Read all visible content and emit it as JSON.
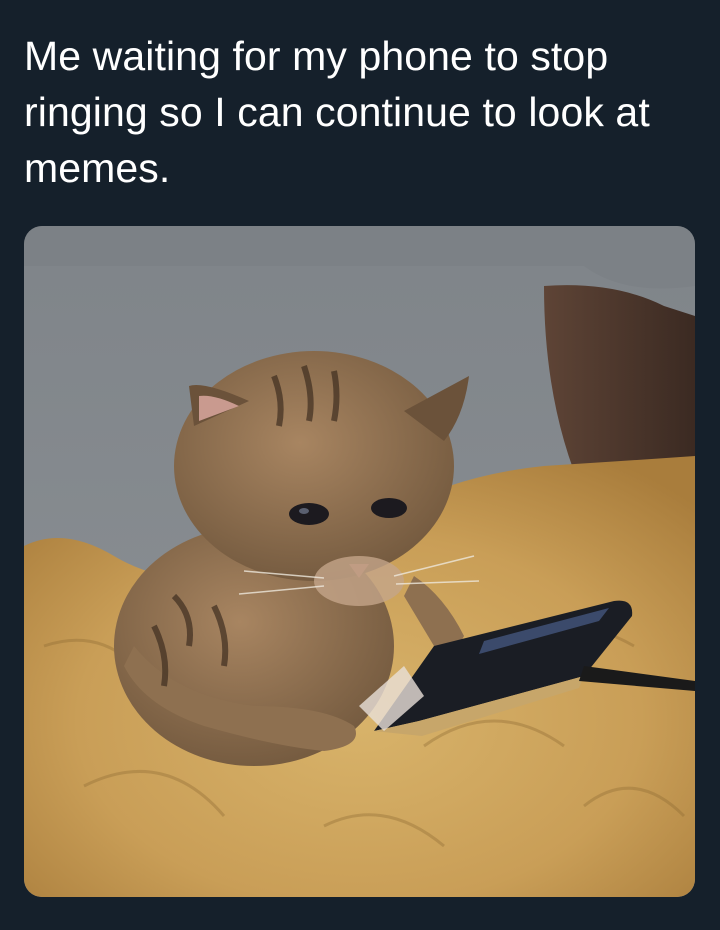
{
  "tweet": {
    "text": "Me waiting for my phone to stop ringing so I can continue to look at memes."
  },
  "colors": {
    "background": "#15202b",
    "text": "#ffffff"
  }
}
